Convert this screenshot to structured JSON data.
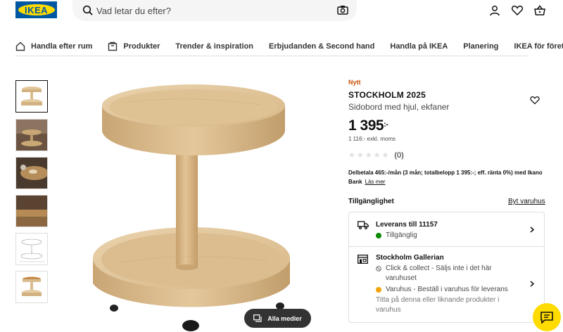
{
  "header": {
    "logo_text": "IKEA",
    "search_placeholder": "Vad letar du efter?",
    "icons": [
      "search-icon",
      "camera-icon",
      "user-icon",
      "heart-icon",
      "basket-icon"
    ]
  },
  "nav": {
    "items": [
      {
        "label": "Handla efter rum",
        "icon": "house-icon"
      },
      {
        "label": "Produkter",
        "icon": "box-icon"
      },
      {
        "label": "Trender & inspiration"
      },
      {
        "label": "Erbjudanden & Second hand"
      },
      {
        "label": "Handla på IKEA"
      },
      {
        "label": "Planering"
      },
      {
        "label": "IKEA för företag"
      }
    ]
  },
  "gallery": {
    "thumbnails": 6,
    "media_button": "Alla medier"
  },
  "product": {
    "badge": "Nytt",
    "name": "STOCKHOLM 2025",
    "description": "Sidobord med hjul, ekfaner",
    "price": "1 395",
    "price_suffix": ":-",
    "price_ex_vat": "1 116:- exkl. moms",
    "rating_count": "(0)",
    "finance_text": "Delbetala 465:-/mån (3 mån; totalbelopp 1 395:-; eff. ränta 0%) med Ikano Bank",
    "finance_link": "Läs mer"
  },
  "availability": {
    "title": "Tillgänglighet",
    "change_store": "Byt varuhus",
    "delivery_title": "Leverans till 11157",
    "delivery_status": "Tillgänglig",
    "store_name": "Stockholm Gallerian",
    "click_collect": "Click & collect - Säljs inte i det här varuhuset",
    "in_store": "Varuhus - Beställ i varuhus för leverans",
    "in_store_note": "Titta på denna eller liknande produkter i varuhus"
  },
  "colors": {
    "ikea_blue": "#0058a3",
    "ikea_yellow": "#ffdb00",
    "new_orange": "#ca5008",
    "available_green": "#0a8a00",
    "warn_orange": "#f0a30a"
  }
}
